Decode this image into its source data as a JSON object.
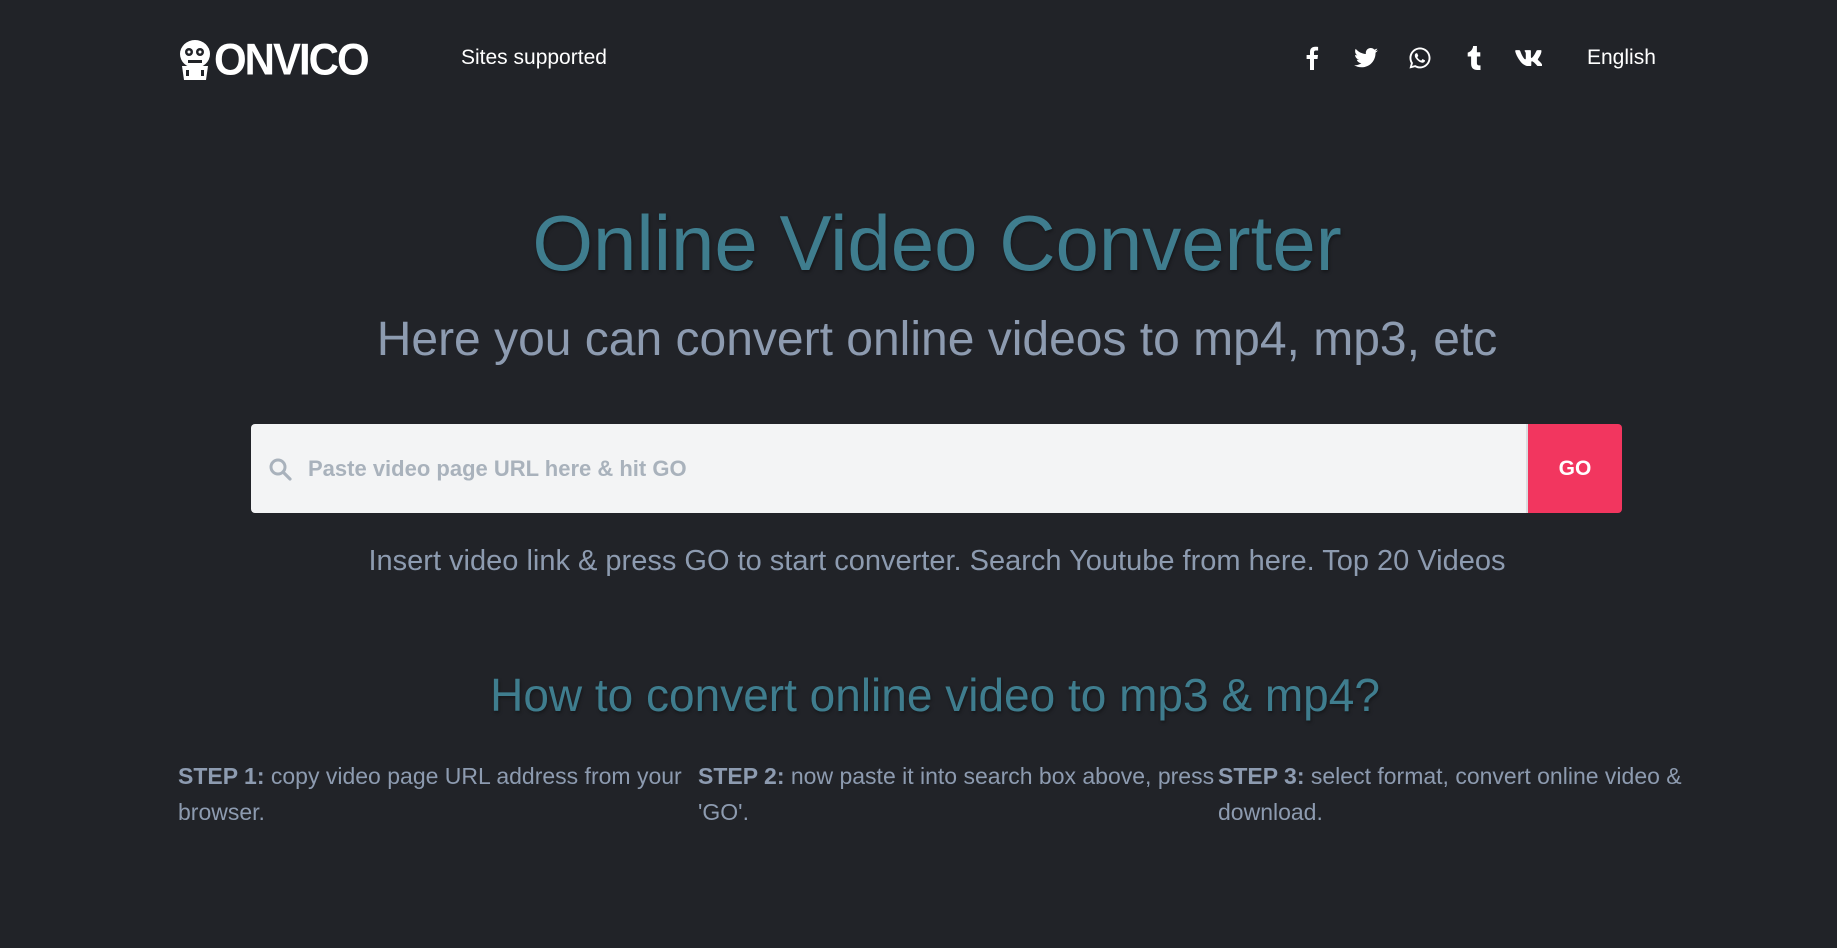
{
  "header": {
    "logo_text": "ONVICO",
    "nav_sites": "Sites supported",
    "language": "English",
    "social": [
      "facebook-icon",
      "twitter-icon",
      "whatsapp-icon",
      "tumblr-icon",
      "vk-icon"
    ]
  },
  "hero": {
    "title": "Online Video Converter",
    "subtitle": "Here you can convert online videos to mp4, mp3, etc"
  },
  "search": {
    "placeholder": "Paste video page URL here & hit GO",
    "value": "",
    "go_label": "GO"
  },
  "hint": {
    "text": "Insert video link & press GO to start converter.",
    "youtube_link": "Search Youtube from here.",
    "top20_link": "Top 20 Videos"
  },
  "howto": {
    "title": "How to convert online video to mp3 & mp4?",
    "steps": [
      {
        "label": "STEP 1:",
        "text": "copy video page URL address from your browser."
      },
      {
        "label": "STEP 2:",
        "text": "now paste it into search box above, press 'GO'."
      },
      {
        "label": "STEP 3:",
        "text": "select format, convert online video & download."
      }
    ]
  },
  "colors": {
    "background": "#212328",
    "accent_title": "#3f7d8e",
    "go_button": "#f2365f",
    "body_text": "#8d9bb0"
  }
}
